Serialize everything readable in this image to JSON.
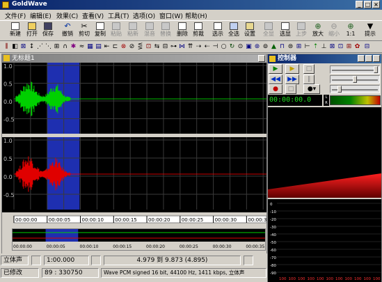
{
  "window": {
    "title": "GoldWave"
  },
  "menu": [
    "文件(F)",
    "编辑(E)",
    "效果(C)",
    "查看(V)",
    "工具(T)",
    "选项(O)",
    "窗口(W)",
    "帮助(H)"
  ],
  "toolbar": [
    {
      "label": "新建",
      "icon": "new-file-icon",
      "enabled": true
    },
    {
      "label": "打开",
      "icon": "open-folder-icon",
      "enabled": true
    },
    {
      "label": "保存",
      "icon": "save-disk-icon",
      "enabled": true
    },
    {
      "label": "撤销",
      "icon": "undo-icon",
      "enabled": true
    },
    {
      "label": "剪切",
      "icon": "scissors-icon",
      "enabled": true
    },
    {
      "label": "复制",
      "icon": "copy-icon",
      "enabled": true
    },
    {
      "label": "粘贴",
      "icon": "paste-icon",
      "enabled": false
    },
    {
      "label": "粘新",
      "icon": "paste-new-icon",
      "enabled": false
    },
    {
      "label": "混音",
      "icon": "mix-icon",
      "enabled": false
    },
    {
      "label": "替换",
      "icon": "replace-icon",
      "enabled": false
    },
    {
      "label": "删除",
      "icon": "delete-icon",
      "enabled": true
    },
    {
      "label": "剪裁",
      "icon": "trim-icon",
      "enabled": true
    },
    {
      "label": "选示",
      "icon": "select-view-icon",
      "enabled": true
    },
    {
      "label": "全选",
      "icon": "select-all-icon",
      "enabled": true
    },
    {
      "label": "设置",
      "icon": "settings-icon",
      "enabled": true
    },
    {
      "label": "全显",
      "icon": "show-all-icon",
      "enabled": false
    },
    {
      "label": "选显",
      "icon": "show-selection-icon",
      "enabled": true
    },
    {
      "label": "上步",
      "icon": "previous-icon",
      "enabled": false
    },
    {
      "label": "放大",
      "icon": "zoom-in-icon",
      "enabled": true
    },
    {
      "label": "缩小",
      "icon": "zoom-out-icon",
      "enabled": false
    },
    {
      "label": "1:1",
      "icon": "zoom-one-icon",
      "enabled": true
    },
    {
      "label": "提示",
      "icon": "hint-icon",
      "enabled": true
    }
  ],
  "document": {
    "title": "无标题1",
    "channel_scale": [
      "1.0",
      "0.5",
      "0.0",
      "-0.5"
    ],
    "timeline": [
      "00:00:00",
      "00:00:05",
      "00:00:10",
      "00:00:15",
      "00:00:20",
      "00:00:25",
      "00:00:30",
      "00:00:35",
      "00:00:"
    ],
    "selection_start_sec": 4.979,
    "selection_end_sec": 9.873,
    "total_sec": 38
  },
  "status": {
    "channel": "立体声",
    "zoom": "1:00.000",
    "selection": "4.979 到 9.873 (4.895)",
    "state": "已修改",
    "position": "89 : 330750",
    "format": "Wave PCM signed 16 bit, 44100 Hz, 1411 kbps, 立体声"
  },
  "controller": {
    "title": "控制器",
    "time": "00:00:00.0",
    "lr": [
      "L",
      "R"
    ],
    "histogram_labels": [
      "0",
      "-10",
      "-20",
      "-30",
      "-40",
      "-50",
      "-60",
      "-70",
      "-80",
      "-90"
    ],
    "histogram_bottom": [
      "100",
      "100",
      "100",
      "100",
      "100",
      "100",
      "100",
      "100",
      "100",
      "100",
      "100"
    ]
  },
  "colors": {
    "left_wave": "#00d000",
    "right_wave": "#e00000",
    "selection": "#1e2fb0",
    "lcd_text": "#20e020",
    "title_blue": "#0a246a"
  }
}
